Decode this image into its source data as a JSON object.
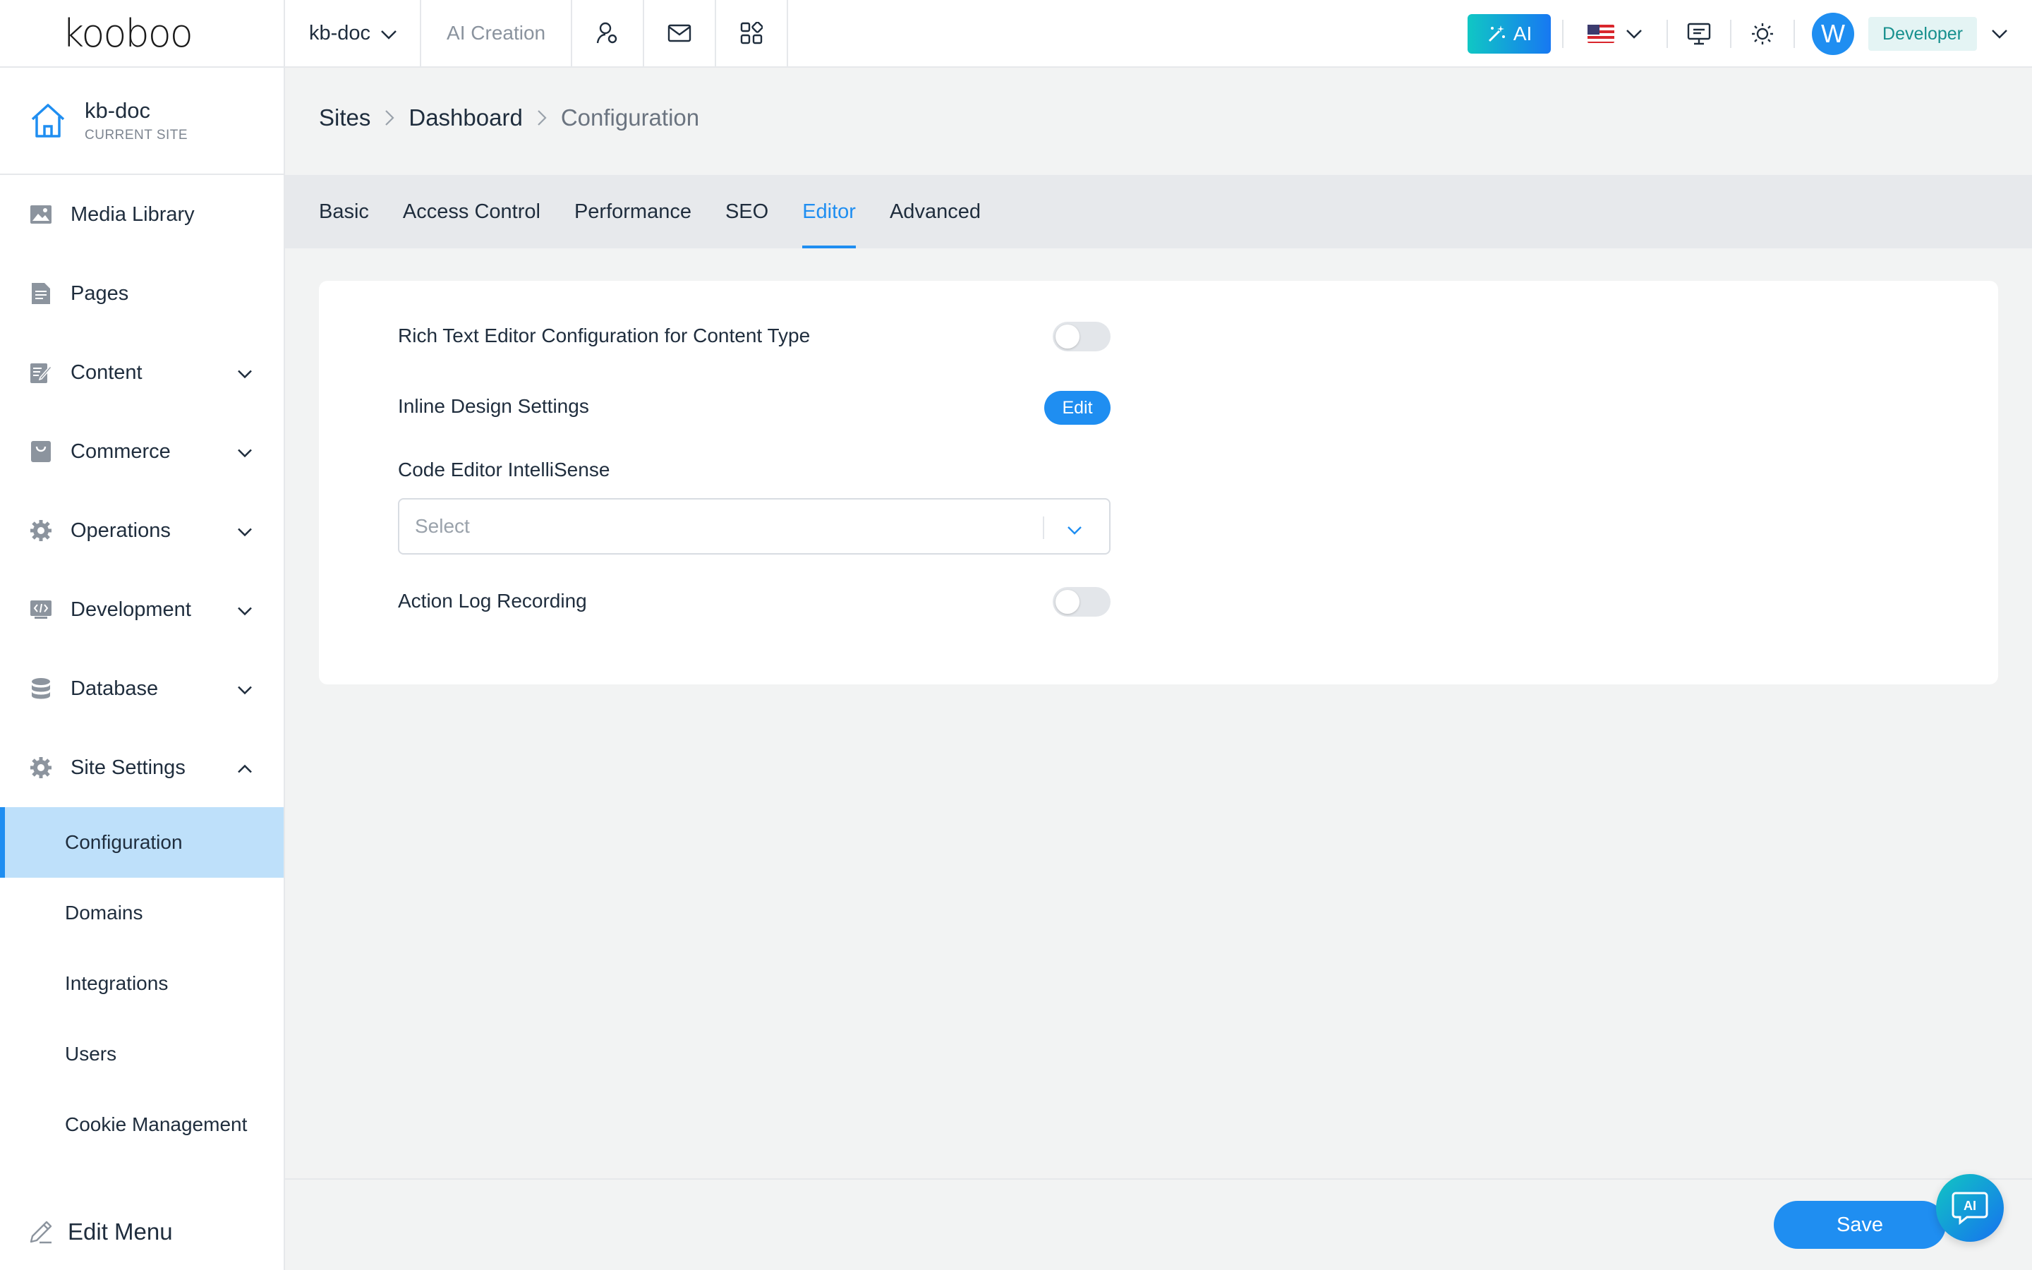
{
  "brand": {
    "logo_text": "kooboo"
  },
  "topbar": {
    "site_name": "kb-doc",
    "ai_creation": "AI Creation",
    "ai_button": "AI",
    "avatar_letter": "W",
    "role": "Developer"
  },
  "sidebar": {
    "current_site": {
      "name": "kb-doc",
      "label": "CURRENT SITE"
    },
    "items": [
      {
        "label": "Media Library",
        "icon": "image-icon",
        "expandable": false
      },
      {
        "label": "Pages",
        "icon": "page-icon",
        "expandable": false
      },
      {
        "label": "Content",
        "icon": "content-icon",
        "expandable": true
      },
      {
        "label": "Commerce",
        "icon": "bag-icon",
        "expandable": true
      },
      {
        "label": "Operations",
        "icon": "gear-icon",
        "expandable": true
      },
      {
        "label": "Development",
        "icon": "code-icon",
        "expandable": true
      },
      {
        "label": "Database",
        "icon": "database-icon",
        "expandable": true
      },
      {
        "label": "Site Settings",
        "icon": "gear-icon",
        "expandable": true,
        "expanded": true
      }
    ],
    "sub_items": [
      {
        "label": "Configuration",
        "active": true
      },
      {
        "label": "Domains"
      },
      {
        "label": "Integrations"
      },
      {
        "label": "Users"
      },
      {
        "label": "Cookie Management"
      }
    ],
    "edit_menu": "Edit Menu"
  },
  "breadcrumb": [
    "Sites",
    "Dashboard",
    "Configuration"
  ],
  "tabs": [
    {
      "label": "Basic"
    },
    {
      "label": "Access Control"
    },
    {
      "label": "Performance"
    },
    {
      "label": "SEO"
    },
    {
      "label": "Editor",
      "active": true
    },
    {
      "label": "Advanced"
    }
  ],
  "editor_settings": {
    "rich_text_label": "Rich Text Editor Configuration for Content Type",
    "rich_text_enabled": false,
    "inline_design_label": "Inline Design Settings",
    "inline_design_button": "Edit",
    "intellisense_label": "Code Editor IntelliSense",
    "intellisense_placeholder": "Select",
    "action_log_label": "Action Log Recording",
    "action_log_enabled": false
  },
  "footer": {
    "save_label": "Save",
    "ai_float": "AI"
  },
  "colors": {
    "accent": "#1f8ef1",
    "active_bg": "#bee0fa",
    "role_text": "#17908e"
  }
}
